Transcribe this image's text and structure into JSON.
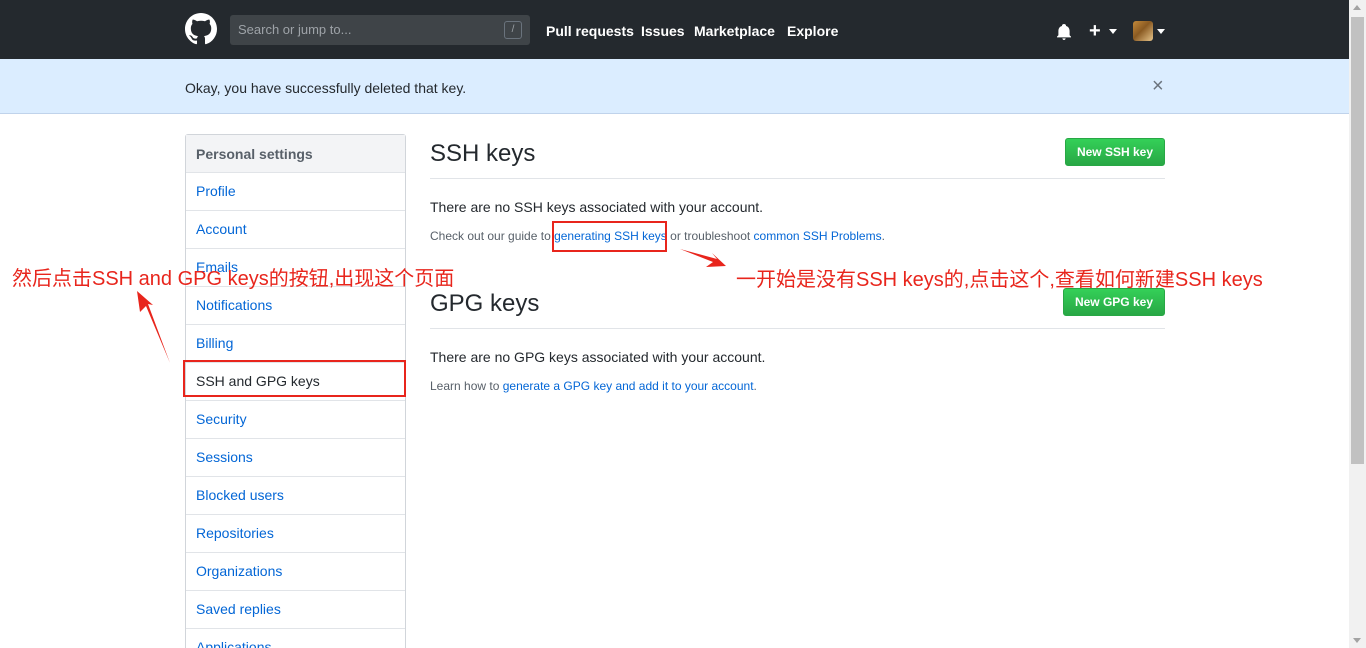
{
  "header": {
    "search_placeholder": "Search or jump to...",
    "search_shortcut": "/",
    "nav": [
      "Pull requests",
      "Issues",
      "Marketplace",
      "Explore"
    ],
    "plus_label": "+"
  },
  "flash": {
    "message": "Okay, you have successfully deleted that key.",
    "close_label": "×"
  },
  "sidebar": {
    "title": "Personal settings",
    "items": [
      {
        "label": "Profile"
      },
      {
        "label": "Account"
      },
      {
        "label": "Emails"
      },
      {
        "label": "Notifications"
      },
      {
        "label": "Billing"
      },
      {
        "label": "SSH and GPG keys"
      },
      {
        "label": "Security"
      },
      {
        "label": "Sessions"
      },
      {
        "label": "Blocked users"
      },
      {
        "label": "Repositories"
      },
      {
        "label": "Organizations"
      },
      {
        "label": "Saved replies"
      },
      {
        "label": "Applications"
      }
    ],
    "selected": "SSH and GPG keys"
  },
  "ssh": {
    "title": "SSH keys",
    "button": "New SSH key",
    "empty": "There are no SSH keys associated with your account.",
    "note_prefix": "Check out our guide to ",
    "note_link1": "generating SSH keys",
    "note_middle": " or troubleshoot ",
    "note_link2": "common SSH Problems",
    "note_suffix": "."
  },
  "gpg": {
    "title": "GPG keys",
    "button": "New GPG key",
    "empty": "There are no GPG keys associated with your account.",
    "note_prefix": "Learn how to ",
    "note_link": "generate a GPG key and add it to your account",
    "note_suffix": "."
  },
  "annotations": {
    "left": "然后点击SSH and GPG keys的按钮,出现这个页面",
    "right": "一开始是没有SSH keys的,点击这个,查看如何新建SSH keys"
  },
  "colors": {
    "header_bg": "#24292e",
    "flash_bg": "#dbedff",
    "link": "#0366d6",
    "button_green": "#28a745",
    "annotation_red": "#e8251c"
  }
}
